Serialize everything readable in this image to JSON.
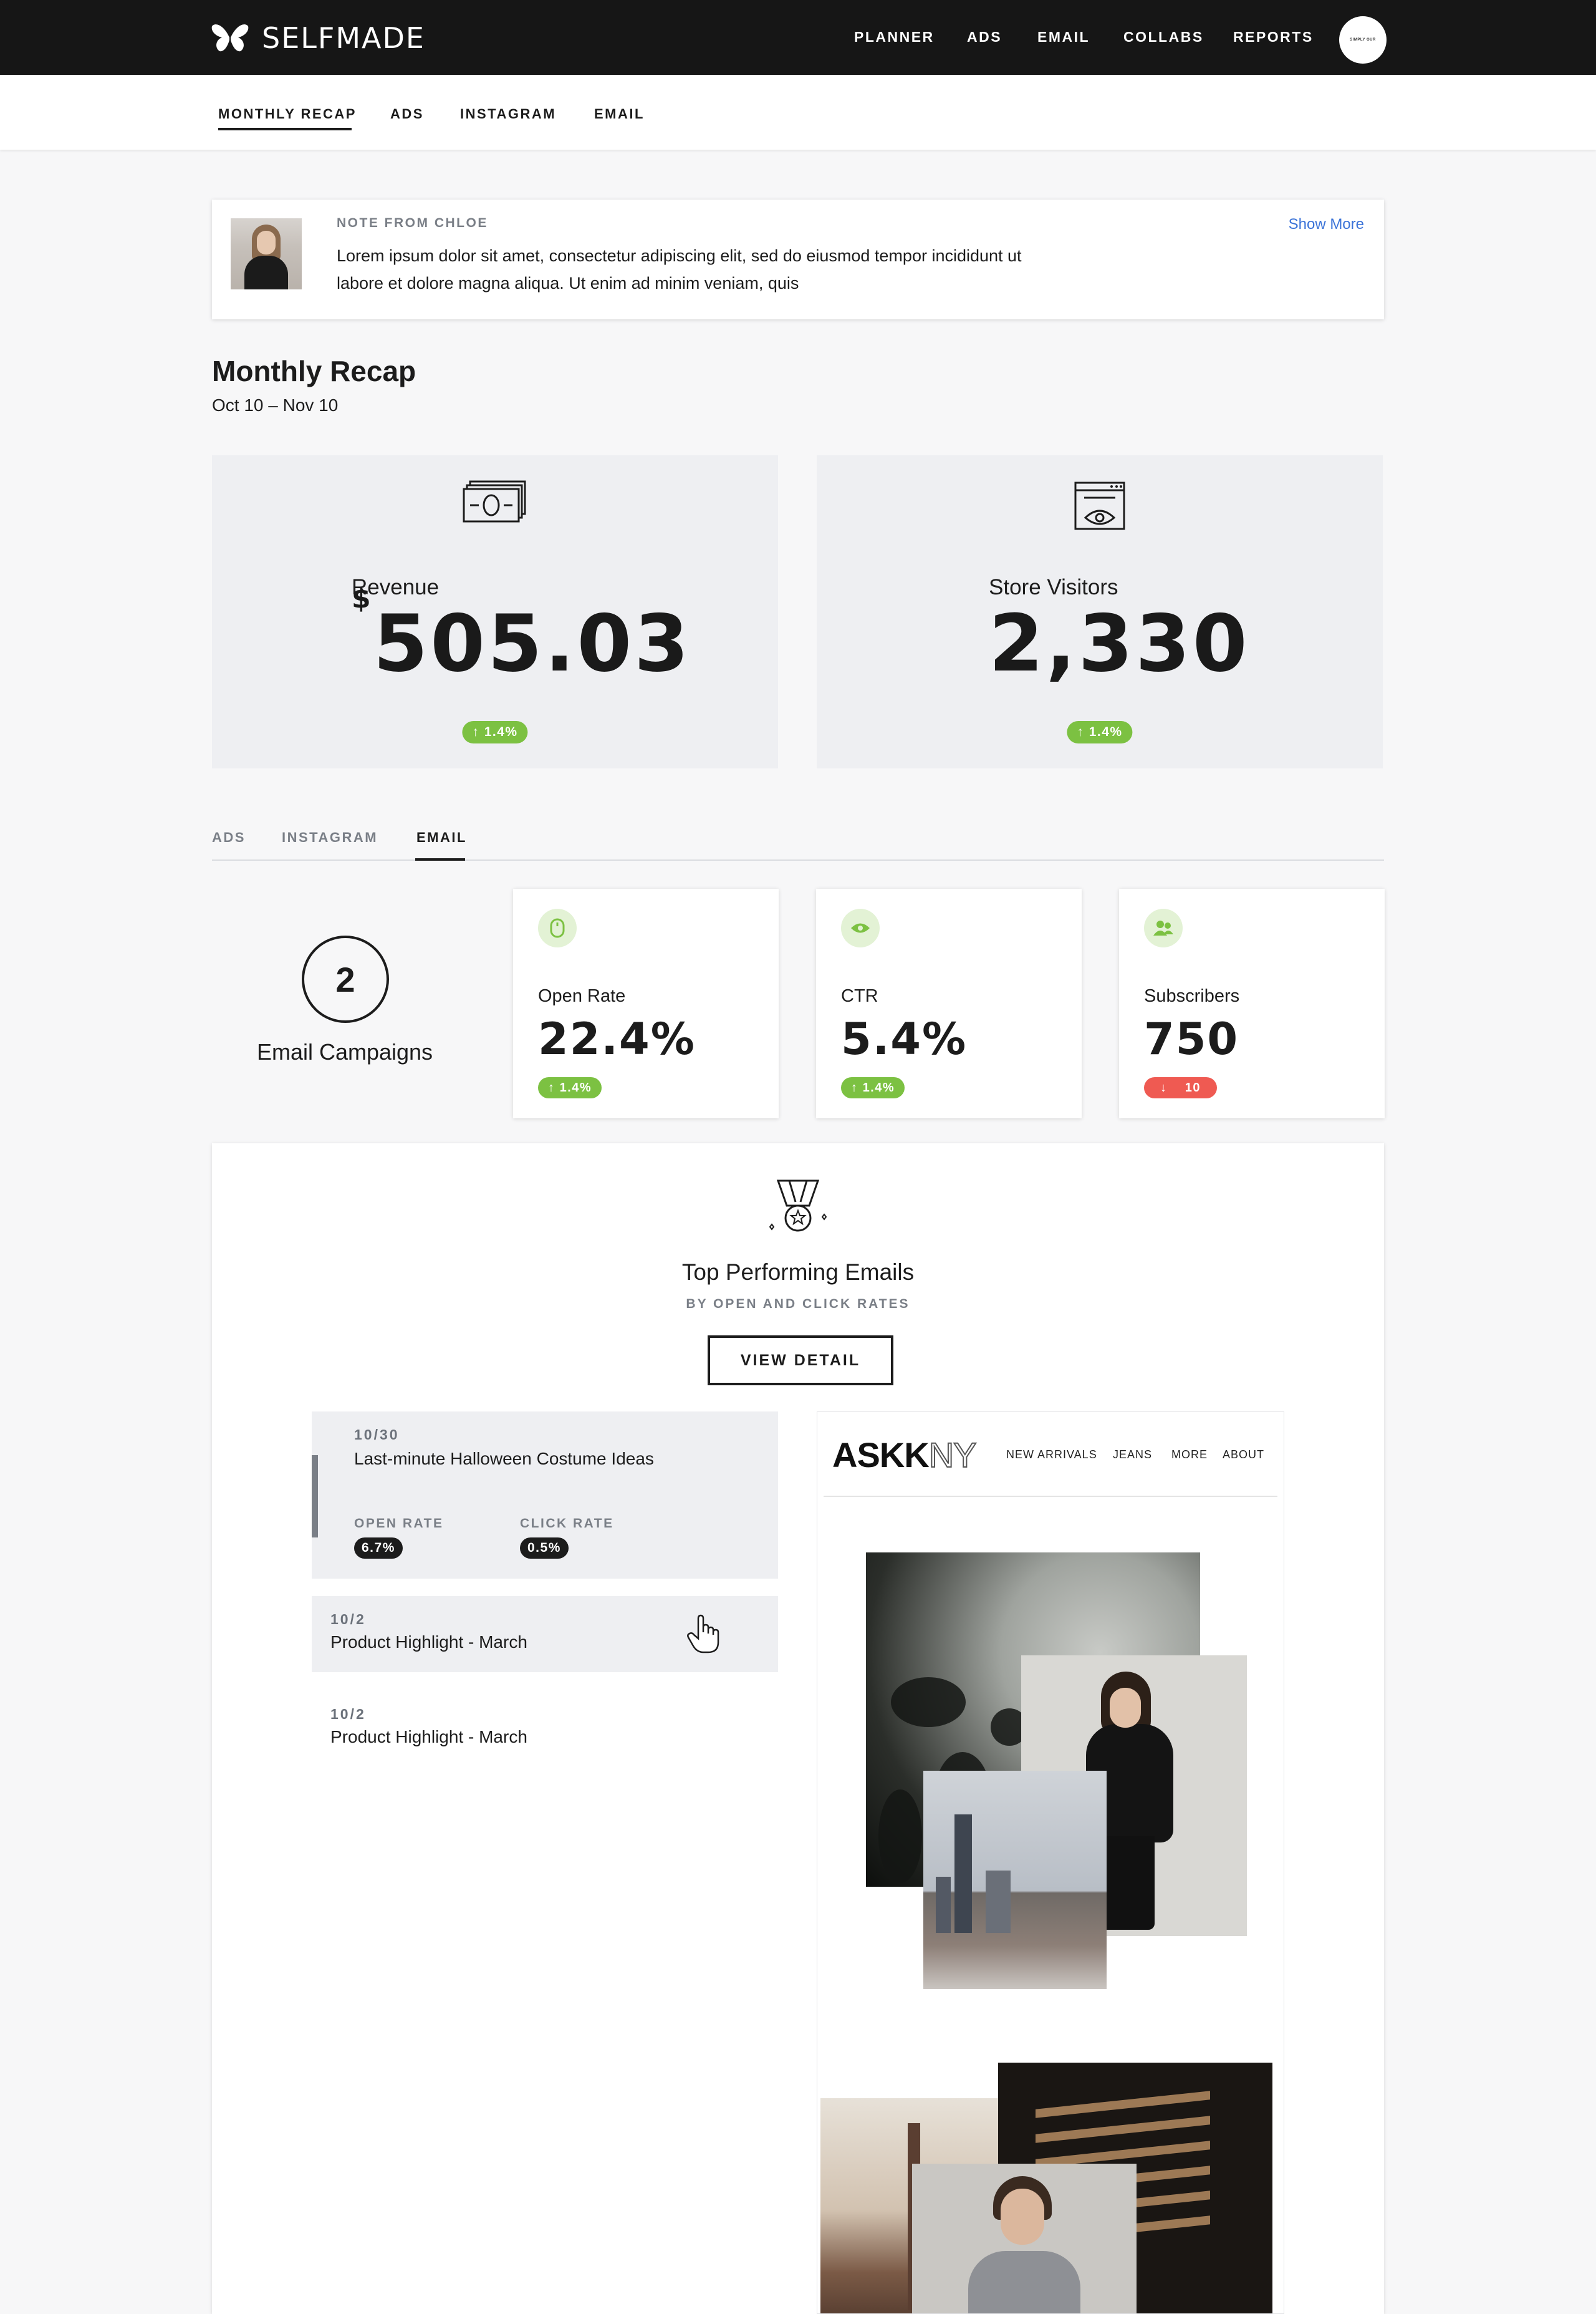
{
  "app": {
    "brand": "SELFMADE",
    "avatar_text": "SIMPLY OUR"
  },
  "topnav": {
    "items": [
      "PLANNER",
      "ADS",
      "EMAIL",
      "COLLABS",
      "REPORTS"
    ]
  },
  "subnav": {
    "items": [
      "MONTHLY RECAP",
      "ADS",
      "INSTAGRAM",
      "EMAIL"
    ],
    "active": "MONTHLY RECAP"
  },
  "note": {
    "label": "NOTE FROM CHLOE",
    "text": "Lorem ipsum dolor sit amet, consectetur adipiscing elit, sed do eiusmod tempor incididunt ut labore et dolore magna aliqua. Ut enim ad minim veniam, quis",
    "show_more": "Show More"
  },
  "recap": {
    "title": "Monthly Recap",
    "date_range": "Oct 10 – Nov 10"
  },
  "revenue": {
    "label": "Revenue",
    "currency": "$",
    "value": "505.03",
    "change": "1.4%"
  },
  "visitors": {
    "label": "Store Visitors",
    "value": "2,330",
    "change": "1.4%"
  },
  "channel_tabs": {
    "items": [
      "ADS",
      "INSTAGRAM",
      "EMAIL"
    ],
    "active": "EMAIL"
  },
  "campaigns": {
    "count": "2",
    "label": "Email Campaigns"
  },
  "metrics": [
    {
      "label": "Open Rate",
      "value": "22.4%",
      "change": "1.4%",
      "direction": "up",
      "icon": "mouse-icon"
    },
    {
      "label": "CTR",
      "value": "5.4%",
      "change": "1.4%",
      "direction": "up",
      "icon": "eye-icon"
    },
    {
      "label": "Subscribers",
      "value": "750",
      "change": "10",
      "direction": "down",
      "icon": "users-icon"
    }
  ],
  "top_emails": {
    "title": "Top Performing Emails",
    "subtitle": "BY OPEN AND CLICK RATES",
    "button": "VIEW DETAIL",
    "items": [
      {
        "date": "10/30",
        "name": "Last-minute Halloween Costume Ideas",
        "open_label": "OPEN RATE",
        "open_rate": "6.7%",
        "click_label": "CLICK RATE",
        "click_rate": "0.5%"
      },
      {
        "date": "10/2",
        "name": "Product Highlight - March"
      },
      {
        "date": "10/2",
        "name": "Product Highlight - March"
      }
    ]
  },
  "preview": {
    "logo_main": "ASKK",
    "logo_suffix": "NY",
    "nav": [
      "NEW ARRIVALS",
      "JEANS",
      "MORE",
      "ABOUT"
    ]
  },
  "colors": {
    "positive": "#7cc142",
    "negative": "#ef5a52",
    "link": "#3b73d8",
    "header_bg": "#161616"
  }
}
